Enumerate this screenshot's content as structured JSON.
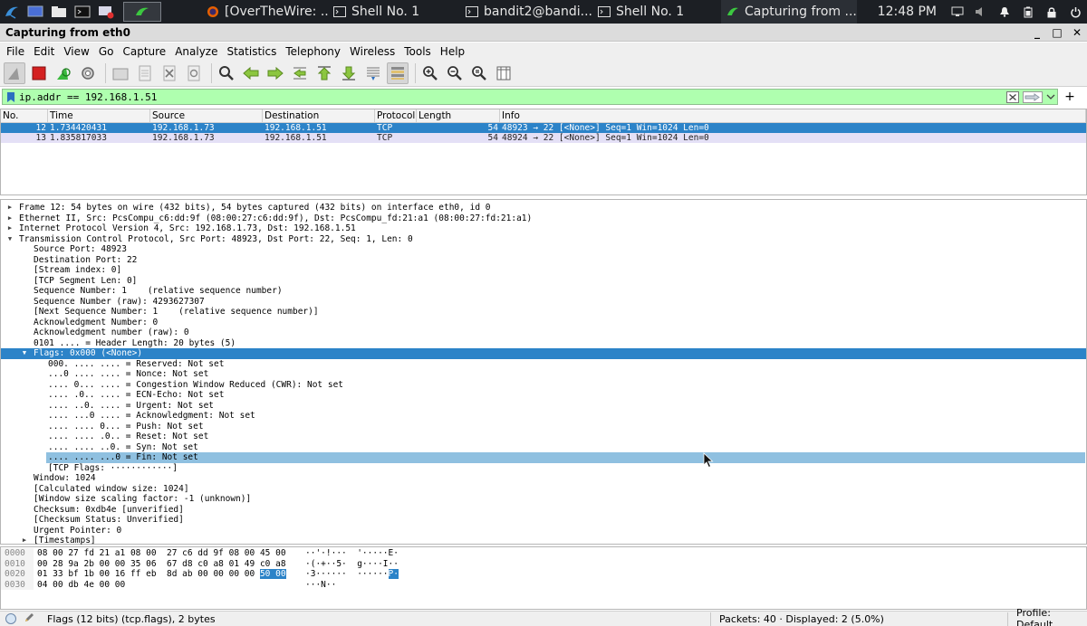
{
  "taskbar": {
    "tasks": [
      {
        "label": "[OverTheWire: ...",
        "icon": "firefox-icon"
      },
      {
        "label": "Shell No. 1",
        "icon": "terminal-icon"
      },
      {
        "label": "bandit2@bandi...",
        "icon": "terminal-icon"
      },
      {
        "label": "Shell No. 1",
        "icon": "terminal-icon"
      },
      {
        "label": "Capturing from ...",
        "icon": "wireshark-icon"
      }
    ],
    "clock": "12:48 PM"
  },
  "window": {
    "title": "Capturing from eth0",
    "controls": [
      "_",
      "□",
      "✕"
    ]
  },
  "menu": [
    "File",
    "Edit",
    "View",
    "Go",
    "Capture",
    "Analyze",
    "Statistics",
    "Telephony",
    "Wireless",
    "Tools",
    "Help"
  ],
  "filter": {
    "value": "ip.addr == 192.168.1.51"
  },
  "packet_list": {
    "columns": [
      "No.",
      "Time",
      "Source",
      "Destination",
      "Protocol",
      "Length",
      "Info"
    ],
    "rows": [
      {
        "no": "12",
        "time": "1.734420431",
        "src": "192.168.1.73",
        "dst": "192.168.1.51",
        "proto": "TCP",
        "len": "54",
        "info": "48923 → 22 [<None>] Seq=1 Win=1024 Len=0"
      },
      {
        "no": "13",
        "time": "1.835817033",
        "src": "192.168.1.73",
        "dst": "192.168.1.51",
        "proto": "TCP",
        "len": "54",
        "info": "48924 → 22 [<None>] Seq=1 Win=1024 Len=0"
      }
    ]
  },
  "detail": {
    "lines": [
      "Frame 12: 54 bytes on wire (432 bits), 54 bytes captured (432 bits) on interface eth0, id 0",
      "Ethernet II, Src: PcsCompu_c6:dd:9f (08:00:27:c6:dd:9f), Dst: PcsCompu_fd:21:a1 (08:00:27:fd:21:a1)",
      "Internet Protocol Version 4, Src: 192.168.1.73, Dst: 192.168.1.51",
      "Transmission Control Protocol, Src Port: 48923, Dst Port: 22, Seq: 1, Len: 0",
      "Source Port: 48923",
      "Destination Port: 22",
      "[Stream index: 0]",
      "[TCP Segment Len: 0]",
      "Sequence Number: 1    (relative sequence number)",
      "Sequence Number (raw): 4293627307",
      "[Next Sequence Number: 1    (relative sequence number)]",
      "Acknowledgment Number: 0",
      "Acknowledgment number (raw): 0",
      "0101 .... = Header Length: 20 bytes (5)",
      "Flags: 0x000 (<None>)",
      "000. .... .... = Reserved: Not set",
      "...0 .... .... = Nonce: Not set",
      ".... 0... .... = Congestion Window Reduced (CWR): Not set",
      ".... .0.. .... = ECN-Echo: Not set",
      ".... ..0. .... = Urgent: Not set",
      ".... ...0 .... = Acknowledgment: Not set",
      ".... .... 0... = Push: Not set",
      ".... .... .0.. = Reset: Not set",
      ".... .... ..0. = Syn: Not set",
      ".... .... ...0 = Fin: Not set",
      "[TCP Flags: ············]",
      "Window: 1024",
      "[Calculated window size: 1024]",
      "[Window size scaling factor: -1 (unknown)]",
      "Checksum: 0xdb4e [unverified]",
      "[Checksum Status: Unverified]",
      "Urgent Pointer: 0",
      "[Timestamps]"
    ]
  },
  "bytes": {
    "rows": [
      {
        "off": "0000",
        "hex_a": "08 00 27 fd 21 a1 08 00  27 c6 dd 9f 08 00 45 00",
        "hex_sel": "",
        "asc_a": "··'·!···  '·····E·",
        "asc_sel": "",
        "asc_b": ""
      },
      {
        "off": "0010",
        "hex_a": "00 28 9a 2b 00 00 35 06  67 d8 c0 a8 01 49 c0 a8",
        "hex_sel": "",
        "asc_a": "·(·+··5·  g····I··",
        "asc_sel": "",
        "asc_b": ""
      },
      {
        "off": "0020",
        "hex_a": "01 33 bf 1b 00 16 ff eb  8d ab 00 00 00 00 ",
        "hex_sel": "50 00",
        "asc_a": "·3······  ······",
        "asc_sel": "P·",
        "asc_b": ""
      },
      {
        "off": "0030",
        "hex_a": "04 00 db 4e 00 00",
        "hex_sel": "",
        "asc_a": "···N··",
        "asc_sel": "",
        "asc_b": ""
      }
    ]
  },
  "status": {
    "field": "Flags (12 bits) (tcp.flags), 2 bytes",
    "packets": "Packets: 40 · Displayed: 2 (5.0%)",
    "profile": "Profile: Default"
  },
  "colors": {
    "selection": "#2c83c8",
    "filter_bg": "#afffaf",
    "alt_row": "#e4e0f6",
    "taskbar": "#1c1f24"
  }
}
